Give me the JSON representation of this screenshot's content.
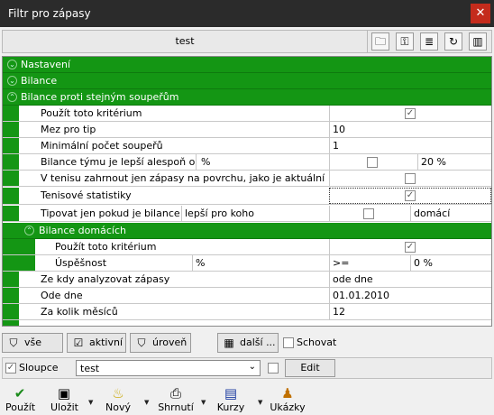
{
  "window": {
    "title": "Filtr pro zápasy",
    "close": "✕"
  },
  "toolbar": {
    "name": "test"
  },
  "sections": {
    "nastaveni": "Nastavení",
    "bilance": "Bilance",
    "bilance_proti": "Bilance proti stejným soupeřům",
    "bilance_domacich": "Bilance domácích"
  },
  "rows": {
    "pouzit": "Použít toto kritérium",
    "mez": "Mez pro tip",
    "mez_val": "10",
    "min": "Minimální počet soupeřů",
    "min_val": "1",
    "bilance_tymu": "Bilance týmu je lepší alespoň o",
    "pct1": "%",
    "val20": "20 %",
    "tenis_povrch": "V tenisu zahrnout jen zápasy na povrchu, jako je aktuální",
    "tenis_stat": "Tenisové statistiky",
    "tipovat": "Tipovat jen pokud je bilance",
    "lepsi": "lepší pro koho",
    "domaci": "domácí",
    "pouzit2": "Použít toto kritérium",
    "uspesnost": "Úspěšnost",
    "pct2": "%",
    "gte": ">=",
    "val0": "0 %",
    "zekdy": "Ze kdy analyzovat zápasy",
    "zekdy_val": "ode dne",
    "odedne": "Ode dne",
    "odedne_val": "01.01.2010",
    "zakolik": "Za kolik měsíců",
    "zakolik_val": "12"
  },
  "checks": {
    "pouzit": "✓",
    "tenis_stat": "✓",
    "pouzit2": "✓"
  },
  "filters": {
    "vse": "vše",
    "aktivni": "aktivní",
    "uroven": "úroveň",
    "dalsi": "další ...",
    "schovat": "Schovat"
  },
  "columns": {
    "sloupce": "Sloupce",
    "select": "test",
    "edit": "Edit"
  },
  "actions": {
    "pouzit": "Použít",
    "ulozit": "Uložit",
    "novy": "Nový",
    "shrnuti": "Shrnutí",
    "kurzy": "Kurzy",
    "ukazky": "Ukázky"
  },
  "icons": [
    "folder-icon",
    "key-icon",
    "list-icon",
    "refresh-icon",
    "columns-icon",
    "funnel-icon",
    "check-icon",
    "save-icon",
    "bulb-icon",
    "print-icon",
    "chart-icon",
    "people-icon"
  ]
}
